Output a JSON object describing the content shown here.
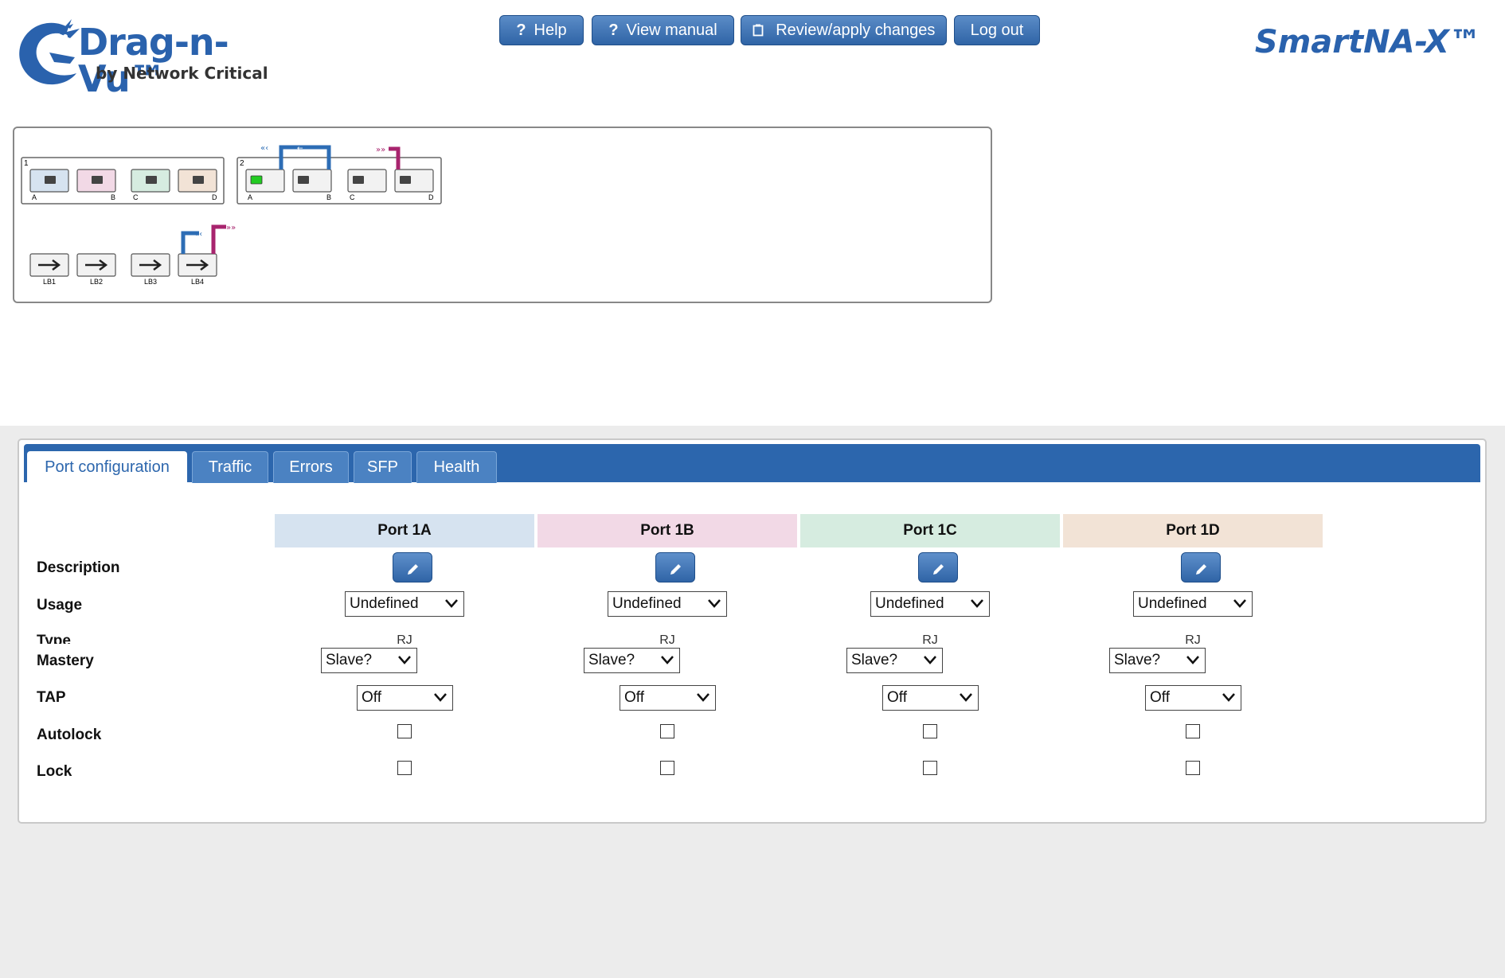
{
  "app": {
    "logo_title": "Drag-n-Vu™",
    "logo_subtitle": "by Network Critical",
    "brand": "SmartNA-X™"
  },
  "toolbar": {
    "help": "Help",
    "view_manual": "View manual",
    "review_apply": "Review/apply changes",
    "logout": "Log out"
  },
  "topology": {
    "module1_label": "1",
    "module2_label": "2",
    "port_letters": [
      "A",
      "B",
      "C",
      "D"
    ],
    "loopbacks": [
      "LB1",
      "LB2",
      "LB3",
      "LB4"
    ],
    "colors": {
      "port_a": "#d6e3f0",
      "port_b": "#f2d9e6",
      "port_c": "#d6ece0",
      "port_d": "#f2e3d6",
      "active_port": "#22cc22",
      "link_blue": "#2d6db5",
      "link_magenta": "#a8246e"
    }
  },
  "tabs": [
    "Port configuration",
    "Traffic",
    "Errors",
    "SFP",
    "Health"
  ],
  "active_tab": "Port configuration",
  "rows": {
    "description": "Description",
    "usage": "Usage",
    "type": "Type",
    "mastery": "Mastery",
    "tap": "TAP",
    "autolock": "Autolock",
    "lock": "Lock"
  },
  "ports": [
    {
      "name": "Port 1A",
      "color": "#d6e3f0",
      "usage": "Undefined",
      "type": "RJ",
      "mastery": "Slave?",
      "tap": "Off",
      "autolock": false,
      "lock": false
    },
    {
      "name": "Port 1B",
      "color": "#f2d9e6",
      "usage": "Undefined",
      "type": "RJ",
      "mastery": "Slave?",
      "tap": "Off",
      "autolock": false,
      "lock": false
    },
    {
      "name": "Port 1C",
      "color": "#d6ece0",
      "usage": "Undefined",
      "type": "RJ",
      "mastery": "Slave?",
      "tap": "Off",
      "autolock": false,
      "lock": false
    },
    {
      "name": "Port 1D",
      "color": "#f2e3d6",
      "usage": "Undefined",
      "type": "RJ",
      "mastery": "Slave?",
      "tap": "Off",
      "autolock": false,
      "lock": false
    }
  ],
  "colors": {
    "accent": "#2c66ad",
    "button": "#3e73b6"
  }
}
